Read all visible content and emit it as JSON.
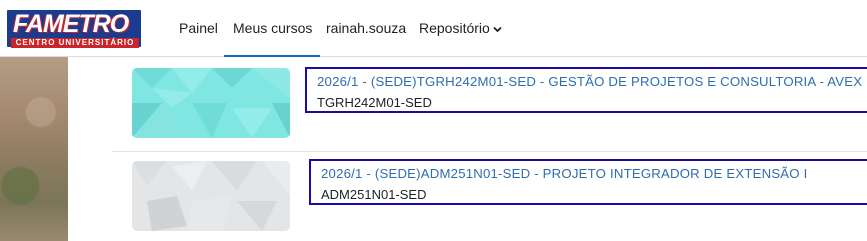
{
  "brand": {
    "logo_main": "FAMETRO",
    "logo_sub": "CENTRO UNIVERSITÁRIO"
  },
  "nav": {
    "items": [
      {
        "label": "Painel"
      },
      {
        "label": "Meus cursos"
      },
      {
        "label": "rainah.souza"
      },
      {
        "label": "Repositório"
      }
    ],
    "active": "Meus cursos"
  },
  "courses": [
    {
      "title": "2026/1 - (SEDE)TGRH242M01-SED - GESTÃO DE PROJETOS E CONSULTORIA - AVEX",
      "code": "TGRH242M01-SED"
    },
    {
      "title": "2026/1 - (SEDE)ADM251N01-SED - PROJETO INTEGRADOR DE EXTENSÃO I",
      "code": "ADM251N01-SED"
    }
  ],
  "colors": {
    "link": "#2f6ead",
    "highlight_box": "#1a0aa8",
    "active_underline": "#0f6cbf",
    "thumb_teal": "#7fe6e2",
    "thumb_gray": "#e3e5e7"
  }
}
